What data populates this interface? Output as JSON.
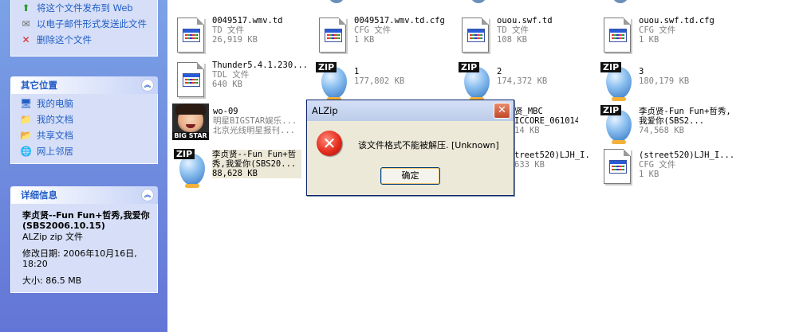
{
  "sidebar": {
    "file_tasks": [
      {
        "icon": "publish-web-icon",
        "label": "将这个文件发布到 Web"
      },
      {
        "icon": "email-icon",
        "label": "以电子邮件形式发送此文件"
      },
      {
        "icon": "delete-x-icon",
        "label": "删除这个文件"
      }
    ],
    "other_places": {
      "title": "其它位置",
      "items": [
        {
          "icon": "my-computer-icon",
          "label": "我的电脑"
        },
        {
          "icon": "my-documents-icon",
          "label": "我的文档"
        },
        {
          "icon": "shared-documents-icon",
          "label": "共享文档"
        },
        {
          "icon": "network-places-icon",
          "label": "网上邻居"
        }
      ]
    },
    "details": {
      "title": "详细信息",
      "file_name": "李贞贤--Fun Fun+哲秀,我爱你(SBS2006.10.15)",
      "file_type": "ALZip zip 文件",
      "modified": "修改日期: 2006年10月16日, 18:20",
      "size": "大小: 86.5 MB"
    }
  },
  "files": [
    {
      "name": "0049517.wmv.td",
      "type": "TD 文件",
      "size": "26,919 KB",
      "icon": "td-file-icon"
    },
    {
      "name": "0049517.wmv.td.cfg",
      "type": "CFG 文件",
      "size": "1 KB",
      "icon": "cfg-file-icon"
    },
    {
      "name": "ouou.swf.td",
      "type": "TD 文件",
      "size": "108 KB",
      "icon": "td-file-icon"
    },
    {
      "name": "ouou.swf.td.cfg",
      "type": "CFG 文件",
      "size": "1 KB",
      "icon": "cfg-file-icon"
    },
    {
      "name": "Thunder5.4.1.230...",
      "type": "TDL 文件",
      "size": "640 KB",
      "icon": "tdl-file-icon"
    },
    {
      "name": "1",
      "type": "",
      "size": "177,802 KB",
      "icon": "zip-icon"
    },
    {
      "name": "2",
      "type": "",
      "size": "174,372 KB",
      "icon": "zip-icon"
    },
    {
      "name": "3",
      "type": "",
      "size": "180,179 KB",
      "icon": "zip-icon"
    },
    {
      "name": "wo-09",
      "type": "明星BIGSTAR娱乐...",
      "size": "北京光线明星报刊...",
      "icon": "video-thumbnail"
    },
    {
      "name": "贤_MBC",
      "type": "ICCORE_061014",
      "size": "14 KB",
      "icon": "zip-icon"
    },
    {
      "name": "李贞贤-Fun Fun+哲秀,我爱你(SBS2...",
      "type": "",
      "size": "74,568 KB",
      "icon": "zip-icon"
    },
    {
      "name": "李贞贤--Fun Fun+哲秀,我爱你(SBS20...",
      "type": "",
      "size": "88,628 KB",
      "icon": "zip-icon"
    },
    {
      "name": "treet520)LJH_I...",
      "type": "",
      "size": "633 KB",
      "icon": "zip-icon"
    },
    {
      "name": "(street520)LJH_I...",
      "type": "CFG 文件",
      "size": "1 KB",
      "icon": "cfg-file-icon"
    }
  ],
  "thumb_caption": "BIG STAR",
  "zip_tag": "ZIP",
  "dialog": {
    "title": "ALZip",
    "close_glyph": "✕",
    "error_glyph": "✕",
    "message": "该文件格式不能被解压. [Unknown]",
    "ok_label": "确定"
  },
  "colors": {
    "taskpane_top": "#7ba2e7",
    "taskpane_bottom": "#6375d6",
    "link": "#215dc6",
    "error_red": "#e52d1d"
  }
}
